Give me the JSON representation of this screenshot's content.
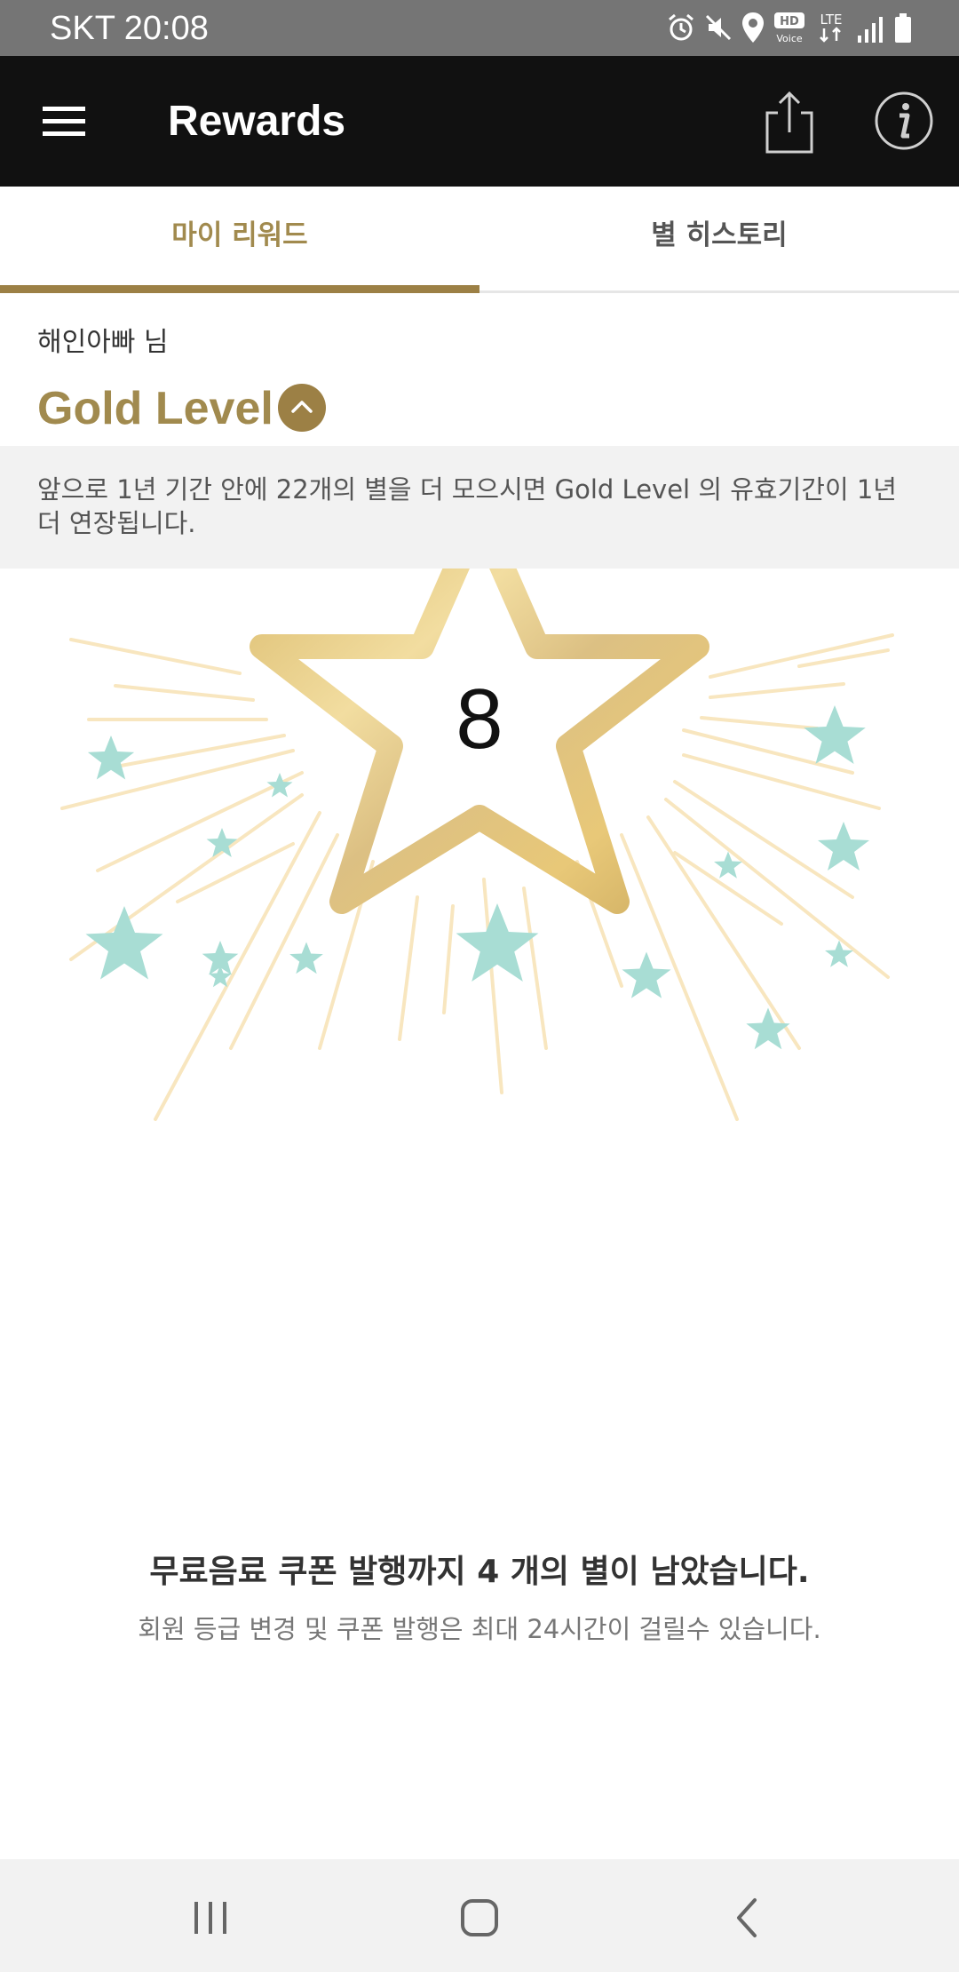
{
  "status_bar": {
    "carrier_time": "SKT 20:08",
    "icons": [
      "alarm-icon",
      "mute-icon",
      "location-icon",
      "hd-voice-icon",
      "lte-icon",
      "signal-icon",
      "battery-icon"
    ],
    "hd_label": "HD",
    "voice_label": "Voice",
    "lte_label": "LTE"
  },
  "app_bar": {
    "title": "Rewards",
    "menu_icon": "hamburger-menu-icon",
    "share_icon": "share-icon",
    "info_icon": "info-icon"
  },
  "tabs": [
    {
      "label": "마이 리워드",
      "active": true
    },
    {
      "label": "별 히스토리",
      "active": false
    }
  ],
  "member": {
    "name": "해인아빠 님",
    "level": "Gold Level",
    "toggle_icon": "chevron-up-icon"
  },
  "notice": {
    "text": "앞으로 1년 기간 안에 22개의 별을 더 모으시면 Gold Level 의 유효기간이 1년 더 연장됩니다."
  },
  "stars": {
    "count": "8"
  },
  "coupon": {
    "message": "무료음료 쿠폰 발행까지 4 개의 별이 남았습니다.",
    "note": "회원 등급 변경 및 쿠폰 발행은 최대 24시간이 걸릴수 있습니다."
  },
  "nav_bar": {
    "recent_icon": "recent-apps-icon",
    "home_icon": "home-icon",
    "back_icon": "back-icon"
  },
  "colors": {
    "accent_gold": "#a18a4e",
    "app_bar": "#111111",
    "status_bar": "#757575",
    "mint_star": "#a8ddd4"
  }
}
